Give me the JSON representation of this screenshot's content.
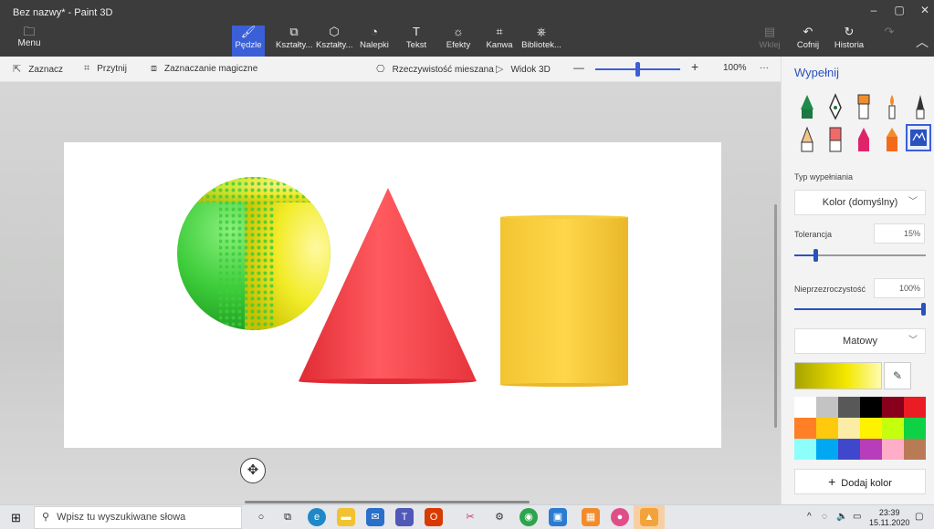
{
  "window": {
    "title": "Bez nazwy* - Paint 3D",
    "controls": [
      "–",
      "▢",
      "✕"
    ]
  },
  "ribbon": {
    "menu": {
      "label": "Menu",
      "icon": "folder-icon"
    },
    "tools": [
      {
        "label": "Pędzle",
        "icon": "brush-icon",
        "active": true
      },
      {
        "label": "Kształty...",
        "icon": "shapes-2d-icon"
      },
      {
        "label": "Kształty...",
        "icon": "shapes-3d-icon"
      },
      {
        "label": "Nalepki",
        "icon": "sticker-icon"
      },
      {
        "label": "Tekst",
        "icon": "text-icon"
      },
      {
        "label": "Efekty",
        "icon": "effects-icon"
      },
      {
        "label": "Kanwa",
        "icon": "canvas-icon"
      },
      {
        "label": "Bibliotek...",
        "icon": "library-icon"
      }
    ],
    "right_tools": [
      {
        "label": "Wklej",
        "icon": "paste-icon",
        "disabled": true
      },
      {
        "label": "Cofnij",
        "icon": "undo-icon"
      },
      {
        "label": "Historia",
        "icon": "history-icon"
      },
      {
        "label": "",
        "icon": "redo-icon",
        "disabled": true
      }
    ]
  },
  "toolbar2": {
    "select": "Zaznacz",
    "crop": "Przytnij",
    "magic_select": "Zaznaczanie magiczne",
    "mixed_reality": "Rzeczywistość mieszana",
    "view3d": "Widok 3D",
    "zoom_minus": "—",
    "zoom_plus": "+",
    "zoom": "100%",
    "more": "···",
    "zoom_level_fraction": 0.48
  },
  "panel": {
    "title": "Wypełnij",
    "fill_type_label": "Typ wypełniania",
    "fill_type_value": "Kolor (domyślny)",
    "tolerance_label": "Tolerancja",
    "tolerance_value": "15%",
    "tolerance_fraction": 0.15,
    "opacity_label": "Nieprzezroczystość",
    "opacity_value": "100%",
    "opacity_fraction": 1.0,
    "finish_value": "Matowy",
    "add_color": "Dodaj kolor",
    "palette": [
      "#ffffff",
      "#c3c3c3",
      "#585858",
      "#000000",
      "#88001b",
      "#ec1c24",
      "#ff7f27",
      "#ffc90e",
      "#fdeca6",
      "#fff200",
      "#c4ff0e",
      "#0ed145",
      "#8cfffb",
      "#00a8f3",
      "#3f48cc",
      "#b83dba",
      "#ffaec8",
      "#b97a56"
    ],
    "selected_color": "#f4e800"
  },
  "taskbar": {
    "search_placeholder": "Wpisz tu wyszukiwane słowa",
    "time": "23:39",
    "date": "15.11.2020"
  }
}
